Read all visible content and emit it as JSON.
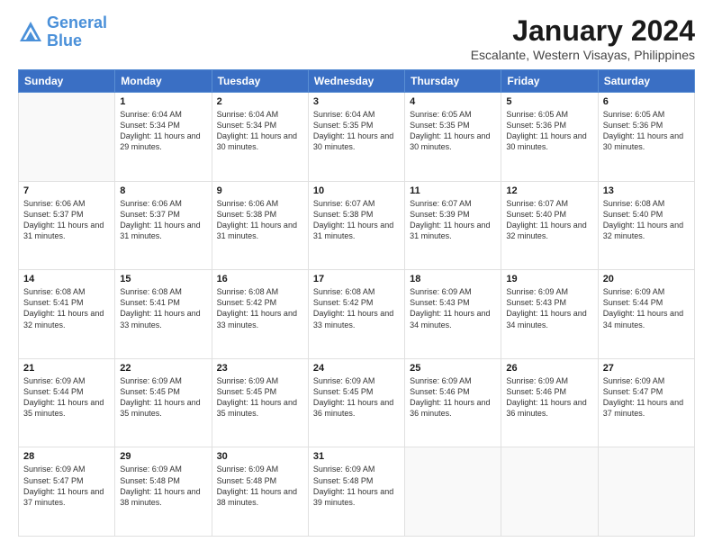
{
  "header": {
    "logo_line1": "General",
    "logo_line2": "Blue",
    "month_title": "January 2024",
    "location": "Escalante, Western Visayas, Philippines"
  },
  "weekdays": [
    "Sunday",
    "Monday",
    "Tuesday",
    "Wednesday",
    "Thursday",
    "Friday",
    "Saturday"
  ],
  "weeks": [
    [
      {
        "day": "",
        "sunrise": "",
        "sunset": "",
        "daylight": ""
      },
      {
        "day": "1",
        "sunrise": "Sunrise: 6:04 AM",
        "sunset": "Sunset: 5:34 PM",
        "daylight": "Daylight: 11 hours and 29 minutes."
      },
      {
        "day": "2",
        "sunrise": "Sunrise: 6:04 AM",
        "sunset": "Sunset: 5:34 PM",
        "daylight": "Daylight: 11 hours and 30 minutes."
      },
      {
        "day": "3",
        "sunrise": "Sunrise: 6:04 AM",
        "sunset": "Sunset: 5:35 PM",
        "daylight": "Daylight: 11 hours and 30 minutes."
      },
      {
        "day": "4",
        "sunrise": "Sunrise: 6:05 AM",
        "sunset": "Sunset: 5:35 PM",
        "daylight": "Daylight: 11 hours and 30 minutes."
      },
      {
        "day": "5",
        "sunrise": "Sunrise: 6:05 AM",
        "sunset": "Sunset: 5:36 PM",
        "daylight": "Daylight: 11 hours and 30 minutes."
      },
      {
        "day": "6",
        "sunrise": "Sunrise: 6:05 AM",
        "sunset": "Sunset: 5:36 PM",
        "daylight": "Daylight: 11 hours and 30 minutes."
      }
    ],
    [
      {
        "day": "7",
        "sunrise": "Sunrise: 6:06 AM",
        "sunset": "Sunset: 5:37 PM",
        "daylight": "Daylight: 11 hours and 31 minutes."
      },
      {
        "day": "8",
        "sunrise": "Sunrise: 6:06 AM",
        "sunset": "Sunset: 5:37 PM",
        "daylight": "Daylight: 11 hours and 31 minutes."
      },
      {
        "day": "9",
        "sunrise": "Sunrise: 6:06 AM",
        "sunset": "Sunset: 5:38 PM",
        "daylight": "Daylight: 11 hours and 31 minutes."
      },
      {
        "day": "10",
        "sunrise": "Sunrise: 6:07 AM",
        "sunset": "Sunset: 5:38 PM",
        "daylight": "Daylight: 11 hours and 31 minutes."
      },
      {
        "day": "11",
        "sunrise": "Sunrise: 6:07 AM",
        "sunset": "Sunset: 5:39 PM",
        "daylight": "Daylight: 11 hours and 31 minutes."
      },
      {
        "day": "12",
        "sunrise": "Sunrise: 6:07 AM",
        "sunset": "Sunset: 5:40 PM",
        "daylight": "Daylight: 11 hours and 32 minutes."
      },
      {
        "day": "13",
        "sunrise": "Sunrise: 6:08 AM",
        "sunset": "Sunset: 5:40 PM",
        "daylight": "Daylight: 11 hours and 32 minutes."
      }
    ],
    [
      {
        "day": "14",
        "sunrise": "Sunrise: 6:08 AM",
        "sunset": "Sunset: 5:41 PM",
        "daylight": "Daylight: 11 hours and 32 minutes."
      },
      {
        "day": "15",
        "sunrise": "Sunrise: 6:08 AM",
        "sunset": "Sunset: 5:41 PM",
        "daylight": "Daylight: 11 hours and 33 minutes."
      },
      {
        "day": "16",
        "sunrise": "Sunrise: 6:08 AM",
        "sunset": "Sunset: 5:42 PM",
        "daylight": "Daylight: 11 hours and 33 minutes."
      },
      {
        "day": "17",
        "sunrise": "Sunrise: 6:08 AM",
        "sunset": "Sunset: 5:42 PM",
        "daylight": "Daylight: 11 hours and 33 minutes."
      },
      {
        "day": "18",
        "sunrise": "Sunrise: 6:09 AM",
        "sunset": "Sunset: 5:43 PM",
        "daylight": "Daylight: 11 hours and 34 minutes."
      },
      {
        "day": "19",
        "sunrise": "Sunrise: 6:09 AM",
        "sunset": "Sunset: 5:43 PM",
        "daylight": "Daylight: 11 hours and 34 minutes."
      },
      {
        "day": "20",
        "sunrise": "Sunrise: 6:09 AM",
        "sunset": "Sunset: 5:44 PM",
        "daylight": "Daylight: 11 hours and 34 minutes."
      }
    ],
    [
      {
        "day": "21",
        "sunrise": "Sunrise: 6:09 AM",
        "sunset": "Sunset: 5:44 PM",
        "daylight": "Daylight: 11 hours and 35 minutes."
      },
      {
        "day": "22",
        "sunrise": "Sunrise: 6:09 AM",
        "sunset": "Sunset: 5:45 PM",
        "daylight": "Daylight: 11 hours and 35 minutes."
      },
      {
        "day": "23",
        "sunrise": "Sunrise: 6:09 AM",
        "sunset": "Sunset: 5:45 PM",
        "daylight": "Daylight: 11 hours and 35 minutes."
      },
      {
        "day": "24",
        "sunrise": "Sunrise: 6:09 AM",
        "sunset": "Sunset: 5:45 PM",
        "daylight": "Daylight: 11 hours and 36 minutes."
      },
      {
        "day": "25",
        "sunrise": "Sunrise: 6:09 AM",
        "sunset": "Sunset: 5:46 PM",
        "daylight": "Daylight: 11 hours and 36 minutes."
      },
      {
        "day": "26",
        "sunrise": "Sunrise: 6:09 AM",
        "sunset": "Sunset: 5:46 PM",
        "daylight": "Daylight: 11 hours and 36 minutes."
      },
      {
        "day": "27",
        "sunrise": "Sunrise: 6:09 AM",
        "sunset": "Sunset: 5:47 PM",
        "daylight": "Daylight: 11 hours and 37 minutes."
      }
    ],
    [
      {
        "day": "28",
        "sunrise": "Sunrise: 6:09 AM",
        "sunset": "Sunset: 5:47 PM",
        "daylight": "Daylight: 11 hours and 37 minutes."
      },
      {
        "day": "29",
        "sunrise": "Sunrise: 6:09 AM",
        "sunset": "Sunset: 5:48 PM",
        "daylight": "Daylight: 11 hours and 38 minutes."
      },
      {
        "day": "30",
        "sunrise": "Sunrise: 6:09 AM",
        "sunset": "Sunset: 5:48 PM",
        "daylight": "Daylight: 11 hours and 38 minutes."
      },
      {
        "day": "31",
        "sunrise": "Sunrise: 6:09 AM",
        "sunset": "Sunset: 5:48 PM",
        "daylight": "Daylight: 11 hours and 39 minutes."
      },
      {
        "day": "",
        "sunrise": "",
        "sunset": "",
        "daylight": ""
      },
      {
        "day": "",
        "sunrise": "",
        "sunset": "",
        "daylight": ""
      },
      {
        "day": "",
        "sunrise": "",
        "sunset": "",
        "daylight": ""
      }
    ]
  ]
}
